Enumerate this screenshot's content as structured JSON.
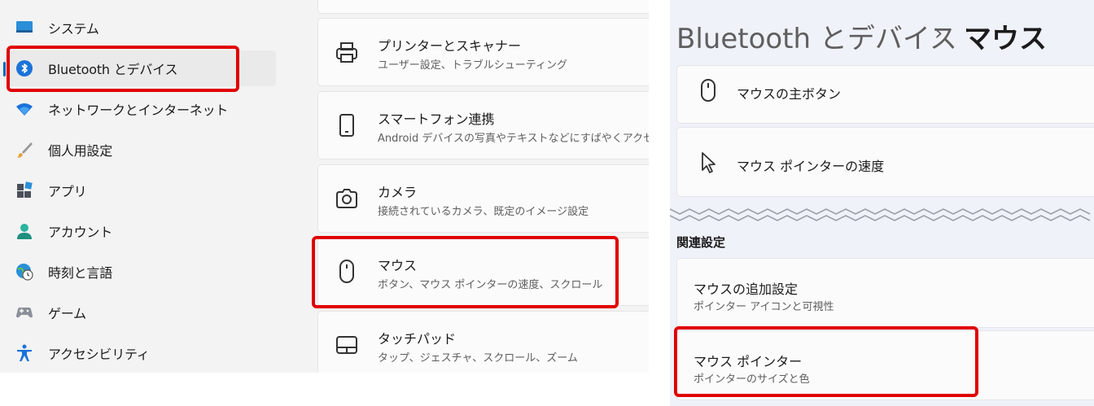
{
  "sidebar": {
    "items": [
      {
        "label": "システム",
        "icon": "system-monitor-icon"
      },
      {
        "label": "Bluetooth とデバイス",
        "icon": "bluetooth-icon",
        "selected": true
      },
      {
        "label": "ネットワークとインターネット",
        "icon": "wifi-icon"
      },
      {
        "label": "個人用設定",
        "icon": "brush-icon"
      },
      {
        "label": "アプリ",
        "icon": "apps-icon"
      },
      {
        "label": "アカウント",
        "icon": "account-icon"
      },
      {
        "label": "時刻と言語",
        "icon": "globe-clock-icon"
      },
      {
        "label": "ゲーム",
        "icon": "gamepad-icon"
      },
      {
        "label": "アクセシビリティ",
        "icon": "accessibility-icon"
      }
    ]
  },
  "devices": {
    "items": [
      {
        "title": "プリンターとスキャナー",
        "subtitle": "ユーザー設定、トラブルシューティング",
        "icon": "printer-icon"
      },
      {
        "title": "スマートフォン連携",
        "subtitle": "Android デバイスの写真やテキストなどにすばやくアクセス",
        "icon": "phone-icon"
      },
      {
        "title": "カメラ",
        "subtitle": "接続されているカメラ、既定のイメージ設定",
        "icon": "camera-icon"
      },
      {
        "title": "マウス",
        "subtitle": "ボタン、マウス ポインターの速度、スクロール",
        "icon": "mouse-icon"
      },
      {
        "title": "タッチパッド",
        "subtitle": "タップ、ジェスチャ、スクロール、ズーム",
        "icon": "touchpad-icon"
      }
    ]
  },
  "mouse_page": {
    "breadcrumb_parent": "Bluetooth とデバイス",
    "breadcrumb_separator": "›",
    "breadcrumb_current": "マウス",
    "settings": [
      {
        "title": "マウスの主ボタン",
        "icon": "mouse-icon"
      },
      {
        "title": "マウス ポインターの速度",
        "icon": "pointer-cursor-icon"
      }
    ],
    "related_heading": "関連設定",
    "related": [
      {
        "title": "マウスの追加設定",
        "subtitle": "ポインター アイコンと可視性"
      },
      {
        "title": "マウス ポインター",
        "subtitle": "ポインターのサイズと色"
      }
    ]
  },
  "colors": {
    "highlight": "#e00000",
    "accent": "#0067c0",
    "sidebar_bg": "#f3f3f3",
    "right_bg": "#eff2f8"
  }
}
